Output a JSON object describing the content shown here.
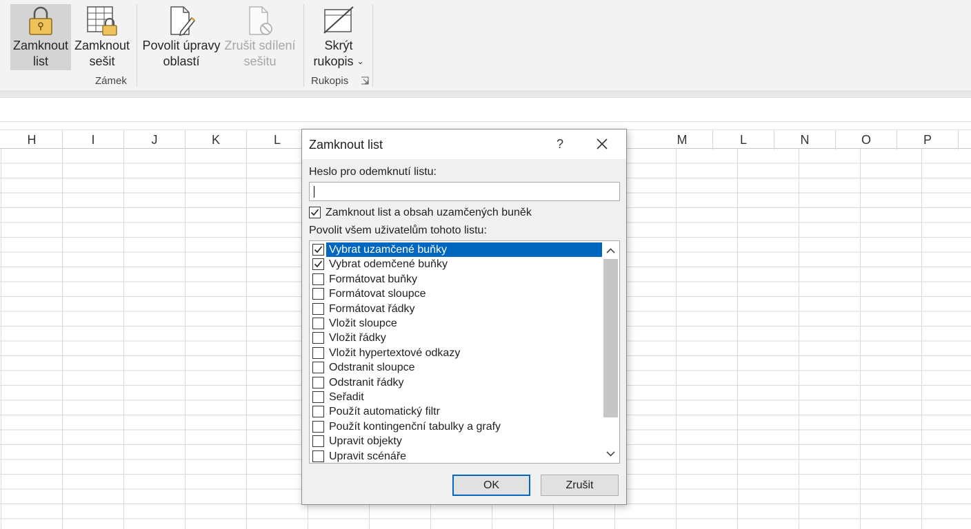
{
  "ribbon": {
    "buttons": {
      "protect_sheet": {
        "line1": "Zamknout",
        "line2": "list"
      },
      "protect_workbook": {
        "line1": "Zamknout",
        "line2": "sešit"
      },
      "allow_edit_ranges": {
        "line1": "Povolit úpravy",
        "line2": "oblastí"
      },
      "unshare_workbook": {
        "line1": "Zrušit sdílení",
        "line2": "sešitu"
      },
      "hide_ink": {
        "line1": "Skrýt",
        "line2": "rukopis"
      }
    },
    "groups": {
      "protect": "Zámek",
      "ink": "Rukopis"
    }
  },
  "columns": [
    "H",
    "I",
    "J",
    "K",
    "L",
    "",
    "",
    "",
    "",
    "",
    "M",
    "L",
    "N",
    "O",
    "P"
  ],
  "dialog": {
    "title": "Zamknout list",
    "help": "?",
    "password_label": "Heslo pro odemknutí listu:",
    "password_value": "",
    "protect_checkbox_label": "Zamknout list a obsah uzamčených buněk",
    "protect_checked": true,
    "allow_label": "Povolit všem uživatelům tohoto listu:",
    "permissions": [
      {
        "label": "Vybrat uzamčené buňky",
        "checked": true,
        "selected": true
      },
      {
        "label": "Vybrat odemčené buňky",
        "checked": true,
        "selected": false
      },
      {
        "label": "Formátovat buňky",
        "checked": false,
        "selected": false
      },
      {
        "label": "Formátovat sloupce",
        "checked": false,
        "selected": false
      },
      {
        "label": "Formátovat řádky",
        "checked": false,
        "selected": false
      },
      {
        "label": "Vložit sloupce",
        "checked": false,
        "selected": false
      },
      {
        "label": "Vložit řádky",
        "checked": false,
        "selected": false
      },
      {
        "label": "Vložit hypertextové odkazy",
        "checked": false,
        "selected": false
      },
      {
        "label": "Odstranit sloupce",
        "checked": false,
        "selected": false
      },
      {
        "label": "Odstranit řádky",
        "checked": false,
        "selected": false
      },
      {
        "label": "Seřadit",
        "checked": false,
        "selected": false
      },
      {
        "label": "Použít automatický filtr",
        "checked": false,
        "selected": false
      },
      {
        "label": "Použít kontingenční tabulky a grafy",
        "checked": false,
        "selected": false
      },
      {
        "label": "Upravit objekty",
        "checked": false,
        "selected": false
      },
      {
        "label": "Upravit scénáře",
        "checked": false,
        "selected": false
      }
    ],
    "ok_label": "OK",
    "cancel_label": "Zrušit"
  },
  "colors": {
    "selection": "#0067c0",
    "lock_gold": "#e8b84a",
    "dialog_bg": "#f0f0f0"
  }
}
